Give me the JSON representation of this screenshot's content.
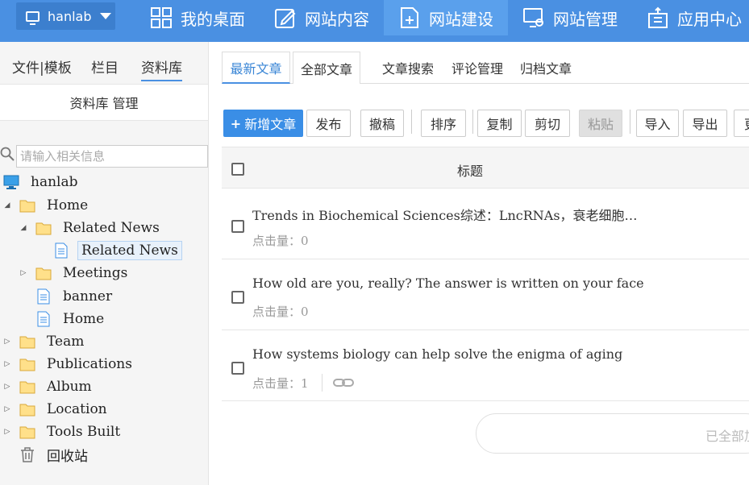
{
  "site_switch": {
    "label": "hanlab"
  },
  "nav": [
    {
      "label": "我的桌面",
      "icon": "dashboard-icon"
    },
    {
      "label": "网站内容",
      "icon": "edit-icon"
    },
    {
      "label": "网站建设",
      "icon": "build-icon"
    },
    {
      "label": "网站管理",
      "icon": "monitor-settings-icon"
    },
    {
      "label": "应用中心",
      "icon": "apps-icon"
    }
  ],
  "sidebar": {
    "tabs": [
      "文件|模板",
      "栏目",
      "资料库"
    ],
    "library_title": "资料库 管理",
    "search_placeholder": "请输入相关信息",
    "tree": [
      {
        "label": "hanlab",
        "icon": "computer-icon"
      },
      {
        "label": "Home",
        "icon": "folder-icon"
      },
      {
        "label": "Related News",
        "icon": "folder-icon"
      },
      {
        "label": "Related News",
        "icon": "document-icon"
      },
      {
        "label": "Meetings",
        "icon": "folder-icon"
      },
      {
        "label": "banner",
        "icon": "document-icon"
      },
      {
        "label": "Home",
        "icon": "document-icon"
      },
      {
        "label": "Team",
        "icon": "folder-icon"
      },
      {
        "label": "Publications",
        "icon": "folder-icon"
      },
      {
        "label": "Album",
        "icon": "folder-icon"
      },
      {
        "label": "Location",
        "icon": "folder-icon"
      },
      {
        "label": "Tools Built",
        "icon": "folder-icon"
      },
      {
        "label": "回收站",
        "icon": "trash-icon"
      }
    ]
  },
  "main": {
    "tabs": [
      "最新文章",
      "全部文章",
      "文章搜索",
      "评论管理",
      "归档文章"
    ],
    "toolbar": {
      "new": "新增文章",
      "publish": "发布",
      "withdraw": "撤稿",
      "sort": "排序",
      "copy": "复制",
      "cut": "剪切",
      "paste": "粘贴",
      "import": "导入",
      "export": "导出",
      "more": "更"
    },
    "table_header": "标题",
    "rows": [
      {
        "title": "Trends in Biochemical Sciences综述：LncRNAs，衰老细胞…",
        "clicks": "点击量：0"
      },
      {
        "title": "How old are you, really? The answer is written on your face",
        "clicks": "点击量：0"
      },
      {
        "title": "How systems biology can help solve the enigma of aging",
        "clicks": "点击量：1"
      }
    ],
    "load_more": "已全部加载"
  }
}
